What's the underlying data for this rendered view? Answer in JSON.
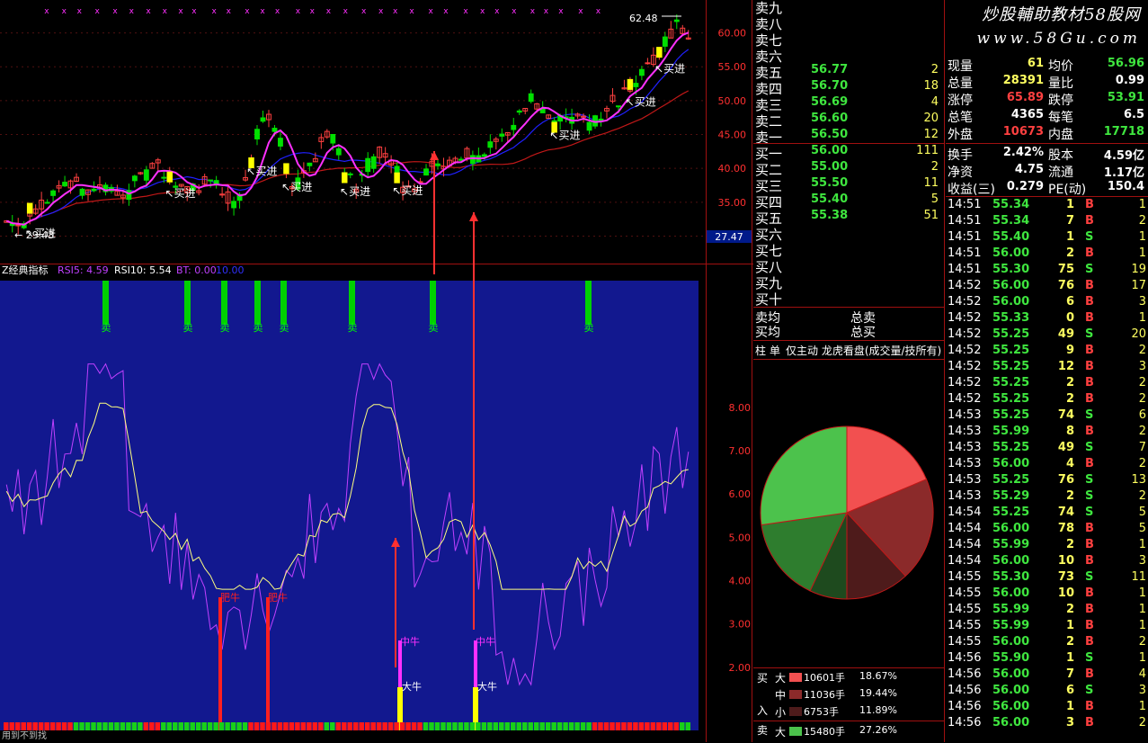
{
  "chart_data": {
    "type": "candlestick",
    "price_axis": {
      "ticks": [
        "60.00",
        "55.00",
        "50.00",
        "45.00",
        "40.00",
        "35.00",
        "30.00"
      ],
      "range": [
        29,
        63
      ]
    },
    "price_labels": {
      "last": "27.47",
      "high": "62.48"
    },
    "annotations": {
      "buy_label": "买进",
      "buy_count": 9,
      "bottom_left": "29.43"
    },
    "indicator": {
      "title": "Z经典指标",
      "readout": [
        "RSI5: 4.59",
        "RSI10: 5.54",
        "BT: 0.00",
        "10.00"
      ],
      "axis_ticks": [
        "8.00",
        "7.00",
        "6.00",
        "5.00",
        "4.00",
        "3.00",
        "2.00"
      ],
      "range": [
        1,
        9.2
      ],
      "sell_marker": "卖",
      "sell_count": 8,
      "signals": {
        "fat_bull": "肥牛",
        "mid_bull": "中牛",
        "big_bull": "大牛"
      },
      "footer": "用到不到找"
    }
  },
  "orderbook": {
    "sell_labels": [
      "卖九",
      "卖八",
      "卖七",
      "卖六",
      "卖五",
      "卖四",
      "卖三",
      "卖二",
      "卖一"
    ],
    "sells": [
      {
        "price": "",
        "vol": ""
      },
      {
        "price": "",
        "vol": ""
      },
      {
        "price": "",
        "vol": ""
      },
      {
        "price": "",
        "vol": ""
      },
      {
        "price": "56.77",
        "vol": "2"
      },
      {
        "price": "56.70",
        "vol": "18"
      },
      {
        "price": "56.69",
        "vol": "4"
      },
      {
        "price": "56.60",
        "vol": "20"
      },
      {
        "price": "56.50",
        "vol": "12"
      }
    ],
    "buy_labels": [
      "买一",
      "买二",
      "买三",
      "买四",
      "买五",
      "买六",
      "买七",
      "买八",
      "买九",
      "买十"
    ],
    "buys": [
      {
        "price": "56.00",
        "vol": "111"
      },
      {
        "price": "55.00",
        "vol": "2"
      },
      {
        "price": "55.50",
        "vol": "11"
      },
      {
        "price": "55.40",
        "vol": "5"
      },
      {
        "price": "55.38",
        "vol": "51"
      },
      {
        "price": "",
        "vol": ""
      },
      {
        "price": "",
        "vol": ""
      },
      {
        "price": "",
        "vol": ""
      },
      {
        "price": "",
        "vol": ""
      },
      {
        "price": "",
        "vol": ""
      }
    ],
    "avg_sell_label": "卖均",
    "total_sell_label": "总卖",
    "avg_buy_label": "买均",
    "total_buy_label": "总买"
  },
  "tabs": [
    "柱",
    "单",
    "仅主动 龙虎看盘(成交量/技所有)"
  ],
  "quote": {
    "rows": [
      [
        {
          "l": "现量",
          "v": "61"
        },
        {
          "l": "均价",
          "v": "56.96"
        }
      ],
      [
        {
          "l": "总量",
          "v": "28391"
        },
        {
          "l": "量比",
          "v": "0.99"
        }
      ],
      [
        {
          "l": "涨停",
          "v": "65.89"
        },
        {
          "l": "跌停",
          "v": "53.91"
        }
      ],
      [
        {
          "l": "总笔",
          "v": "4365"
        },
        {
          "l": "每笔",
          "v": "6.5"
        }
      ],
      [
        {
          "l": "外盘",
          "v": "10673"
        },
        {
          "l": "内盘",
          "v": "17718"
        }
      ]
    ],
    "rows2": [
      [
        {
          "l": "换手",
          "v": "2.42%"
        },
        {
          "l": "股本",
          "v": "4.59亿"
        }
      ],
      [
        {
          "l": "净资",
          "v": "4.75"
        },
        {
          "l": "流通",
          "v": "1.17亿"
        }
      ],
      [
        {
          "l": "收益(三)",
          "v": "0.279"
        },
        {
          "l": "PE(动)",
          "v": "150.4"
        }
      ]
    ]
  },
  "pie": {
    "slices": [
      {
        "label": "大买",
        "value": 18.67,
        "color": "#f25050"
      },
      {
        "label": "中买",
        "value": 19.44,
        "color": "#8b2a2a"
      },
      {
        "label": "小买",
        "value": 11.89,
        "color": "#4e1b1b"
      },
      {
        "label": "小卖",
        "value": 7.0,
        "color": "#1e4a1e"
      },
      {
        "label": "中卖",
        "value": 15.74,
        "color": "#2e7d2e"
      },
      {
        "label": "大卖",
        "value": 27.26,
        "color": "#4cc24c"
      }
    ]
  },
  "flow": {
    "buy_side": [
      "买",
      "入"
    ],
    "sell_side": [
      "卖"
    ],
    "rows": [
      {
        "size": "大",
        "color": "#f25050",
        "vol": "10601手",
        "pct": "18.67%"
      },
      {
        "size": "中",
        "color": "#8b2a2a",
        "vol": "11036手",
        "pct": "19.44%"
      },
      {
        "size": "小",
        "color": "#4e1b1b",
        "vol": "6753手",
        "pct": "11.89%"
      },
      {
        "size": "大",
        "color": "#4cc24c",
        "vol": "15480手",
        "pct": "27.26%"
      }
    ]
  },
  "watermark": {
    "line1": "炒股輔助教材58股网",
    "line2": "www.58Gu.com"
  },
  "trades": [
    {
      "t": "14:51",
      "p": "55.34",
      "v": "1",
      "d": "B",
      "n": "1"
    },
    {
      "t": "14:51",
      "p": "55.34",
      "v": "7",
      "d": "B",
      "n": "2"
    },
    {
      "t": "14:51",
      "p": "55.40",
      "v": "1",
      "d": "S",
      "n": "1"
    },
    {
      "t": "14:51",
      "p": "56.00",
      "v": "2",
      "d": "B",
      "n": "1"
    },
    {
      "t": "14:51",
      "p": "55.30",
      "v": "75",
      "d": "S",
      "n": "19"
    },
    {
      "t": "14:52",
      "p": "56.00",
      "v": "76",
      "d": "B",
      "n": "17"
    },
    {
      "t": "14:52",
      "p": "56.00",
      "v": "6",
      "d": "B",
      "n": "3"
    },
    {
      "t": "14:52",
      "p": "55.33",
      "v": "0",
      "d": "B",
      "n": "1"
    },
    {
      "t": "14:52",
      "p": "55.25",
      "v": "49",
      "d": "S",
      "n": "20"
    },
    {
      "t": "14:52",
      "p": "55.25",
      "v": "9",
      "d": "B",
      "n": "2"
    },
    {
      "t": "14:52",
      "p": "55.25",
      "v": "12",
      "d": "B",
      "n": "3"
    },
    {
      "t": "14:52",
      "p": "55.25",
      "v": "2",
      "d": "B",
      "n": "2"
    },
    {
      "t": "14:52",
      "p": "55.25",
      "v": "2",
      "d": "B",
      "n": "2"
    },
    {
      "t": "14:53",
      "p": "55.25",
      "v": "74",
      "d": "S",
      "n": "6"
    },
    {
      "t": "14:53",
      "p": "55.99",
      "v": "8",
      "d": "B",
      "n": "2"
    },
    {
      "t": "14:53",
      "p": "55.25",
      "v": "49",
      "d": "S",
      "n": "7"
    },
    {
      "t": "14:53",
      "p": "56.00",
      "v": "4",
      "d": "B",
      "n": "2"
    },
    {
      "t": "14:53",
      "p": "55.25",
      "v": "76",
      "d": "S",
      "n": "13"
    },
    {
      "t": "14:53",
      "p": "55.29",
      "v": "2",
      "d": "S",
      "n": "2"
    },
    {
      "t": "14:54",
      "p": "55.25",
      "v": "74",
      "d": "S",
      "n": "5"
    },
    {
      "t": "14:54",
      "p": "56.00",
      "v": "78",
      "d": "B",
      "n": "5"
    },
    {
      "t": "14:54",
      "p": "55.99",
      "v": "2",
      "d": "B",
      "n": "1"
    },
    {
      "t": "14:54",
      "p": "56.00",
      "v": "10",
      "d": "B",
      "n": "3"
    },
    {
      "t": "14:55",
      "p": "55.30",
      "v": "73",
      "d": "S",
      "n": "11"
    },
    {
      "t": "14:55",
      "p": "56.00",
      "v": "10",
      "d": "B",
      "n": "1"
    },
    {
      "t": "14:55",
      "p": "55.99",
      "v": "2",
      "d": "B",
      "n": "1"
    },
    {
      "t": "14:55",
      "p": "55.99",
      "v": "1",
      "d": "B",
      "n": "1"
    },
    {
      "t": "14:55",
      "p": "56.00",
      "v": "2",
      "d": "B",
      "n": "2"
    },
    {
      "t": "14:56",
      "p": "55.90",
      "v": "1",
      "d": "S",
      "n": "1"
    },
    {
      "t": "14:56",
      "p": "56.00",
      "v": "7",
      "d": "B",
      "n": "4"
    },
    {
      "t": "14:56",
      "p": "56.00",
      "v": "6",
      "d": "S",
      "n": "3"
    },
    {
      "t": "14:56",
      "p": "56.00",
      "v": "1",
      "d": "B",
      "n": "1"
    },
    {
      "t": "14:56",
      "p": "56.00",
      "v": "3",
      "d": "B",
      "n": "2"
    },
    {
      "t": "14:57",
      "p": "56.00",
      "v": "",
      "d": "",
      "n": ""
    }
  ],
  "colors": {
    "up": "#ff4040",
    "down": "#00e000",
    "ma5": "#ff30ff",
    "ma10": "#2020ff",
    "ma20": "#c01818",
    "indicator_bg": "#12188f",
    "rsi5": "#c040ff",
    "rsi10": "#ffff80",
    "accent": "#ff2020",
    "yellow": "#ffff00"
  }
}
